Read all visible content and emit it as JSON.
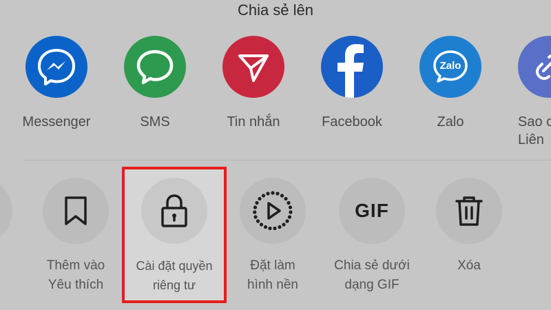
{
  "sheet": {
    "title": "Chia sẻ lên"
  },
  "share_targets": [
    {
      "label": "Messenger",
      "icon": "messenger-icon",
      "color": "#0b63c9"
    },
    {
      "label": "SMS",
      "icon": "sms-icon",
      "color": "#2e9a4f"
    },
    {
      "label": "Tin nhắn",
      "icon": "direct-message-icon",
      "color": "#c8283f"
    },
    {
      "label": "Facebook",
      "icon": "facebook-icon",
      "color": "#1a5fc6"
    },
    {
      "label": "Zalo",
      "icon": "zalo-icon",
      "color": "#1e7fd1"
    },
    {
      "label_line1": "Sao c",
      "label_line2": "Liên",
      "icon": "copy-link-icon",
      "color": "#5a6fc8"
    }
  ],
  "actions": [
    {
      "label_line1": "Thêm vào",
      "label_line2": "Yêu thích",
      "icon": "bookmark-icon"
    },
    {
      "label_line1": "Cài đặt quyền",
      "label_line2": "riêng tư",
      "icon": "lock-icon",
      "highlighted": true
    },
    {
      "label_line1": "Đặt làm",
      "label_line2": "hình nền",
      "icon": "live-wallpaper-icon"
    },
    {
      "label_line1": "Chia sẻ dưới",
      "label_line2": "dạng GIF",
      "icon": "gif-icon",
      "icon_text": "GIF"
    },
    {
      "label_line1": "Xóa",
      "label_line2": "",
      "icon": "trash-icon"
    }
  ],
  "colors": {
    "highlight_border": "#e41e1e"
  }
}
